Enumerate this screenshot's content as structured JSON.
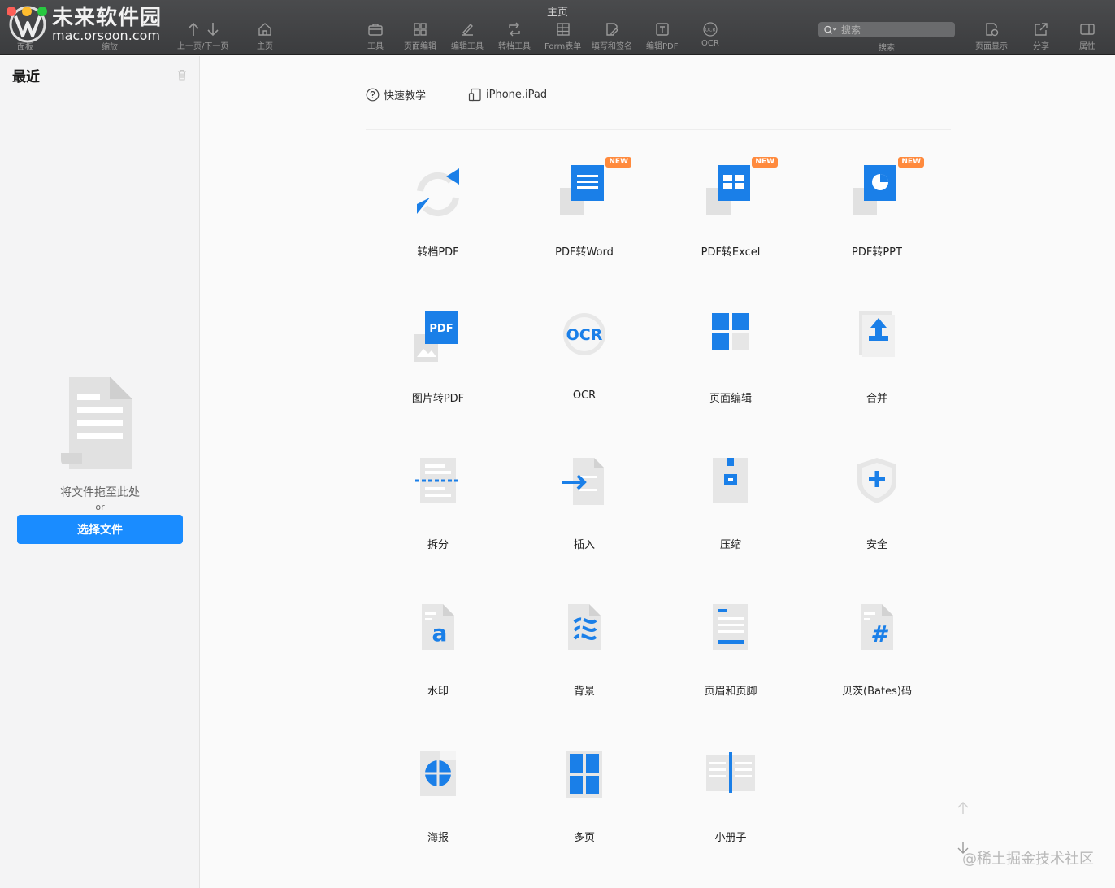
{
  "window": {
    "title": "主页"
  },
  "watermark": {
    "line1": "未来软件园",
    "line2": "mac.orsoon.com",
    "footer": "@稀土掘金技术社区"
  },
  "toolbar": {
    "left": [
      {
        "label": "面板",
        "icon": "panel-icon"
      },
      {
        "label": "缩放",
        "icon": "zoom-icon"
      },
      {
        "label": "上一页/下一页",
        "icon": "prev-next-icon"
      },
      {
        "label": "主页",
        "icon": "home-icon"
      }
    ],
    "center": [
      {
        "label": "工具",
        "icon": "toolbox-icon"
      },
      {
        "label": "页面编辑",
        "icon": "grid-icon"
      },
      {
        "label": "编辑工具",
        "icon": "edit-icon"
      },
      {
        "label": "转档工具",
        "icon": "convert-icon"
      },
      {
        "label": "Form表单",
        "icon": "form-icon"
      },
      {
        "label": "填写和签名",
        "icon": "sign-icon"
      },
      {
        "label": "编辑PDF",
        "icon": "text-box-icon"
      },
      {
        "label": "OCR",
        "icon": "ocr-icon"
      }
    ],
    "search": {
      "placeholder": "搜索",
      "label": "搜索"
    },
    "right": [
      {
        "label": "页面显示",
        "icon": "page-display-icon"
      },
      {
        "label": "分享",
        "icon": "share-icon"
      },
      {
        "label": "属性",
        "icon": "properties-icon"
      }
    ]
  },
  "sidebar": {
    "title": "最近",
    "drop_text": "将文件拖至此处",
    "or_text": "or",
    "choose_button": "选择文件"
  },
  "main": {
    "quick_links": [
      {
        "label": "快速教学",
        "icon": "help-icon"
      },
      {
        "label": "iPhone,iPad",
        "icon": "device-icon"
      }
    ],
    "badge_text": "NEW",
    "tools": [
      {
        "label": "转档PDF",
        "icon": "convert-pdf-icon",
        "new": false
      },
      {
        "label": "PDF转Word",
        "icon": "pdf-to-word-icon",
        "new": true
      },
      {
        "label": "PDF转Excel",
        "icon": "pdf-to-excel-icon",
        "new": true
      },
      {
        "label": "PDF转PPT",
        "icon": "pdf-to-ppt-icon",
        "new": true
      },
      {
        "label": "图片转PDF",
        "icon": "image-to-pdf-icon",
        "new": false,
        "glyph": "PDF"
      },
      {
        "label": "OCR",
        "icon": "ocr-tool-icon",
        "new": false,
        "glyph": "OCR"
      },
      {
        "label": "页面编辑",
        "icon": "page-edit-icon",
        "new": false
      },
      {
        "label": "合并",
        "icon": "merge-icon",
        "new": false
      },
      {
        "label": "拆分",
        "icon": "split-icon",
        "new": false
      },
      {
        "label": "插入",
        "icon": "insert-icon",
        "new": false
      },
      {
        "label": "压缩",
        "icon": "compress-icon",
        "new": false
      },
      {
        "label": "安全",
        "icon": "security-icon",
        "new": false
      },
      {
        "label": "水印",
        "icon": "watermark-icon",
        "new": false,
        "glyph": "a"
      },
      {
        "label": "背景",
        "icon": "background-icon",
        "new": false
      },
      {
        "label": "页眉和页脚",
        "icon": "header-footer-icon",
        "new": false
      },
      {
        "label": "贝茨(Bates)码",
        "icon": "bates-icon",
        "new": false,
        "glyph": "#"
      },
      {
        "label": "海报",
        "icon": "poster-icon",
        "new": false
      },
      {
        "label": "多页",
        "icon": "multi-page-icon",
        "new": false
      },
      {
        "label": "小册子",
        "icon": "booklet-icon",
        "new": false
      }
    ]
  },
  "colors": {
    "accent": "#1a8cff",
    "badge": "#ff8a3d",
    "toolbar": "#414244"
  }
}
